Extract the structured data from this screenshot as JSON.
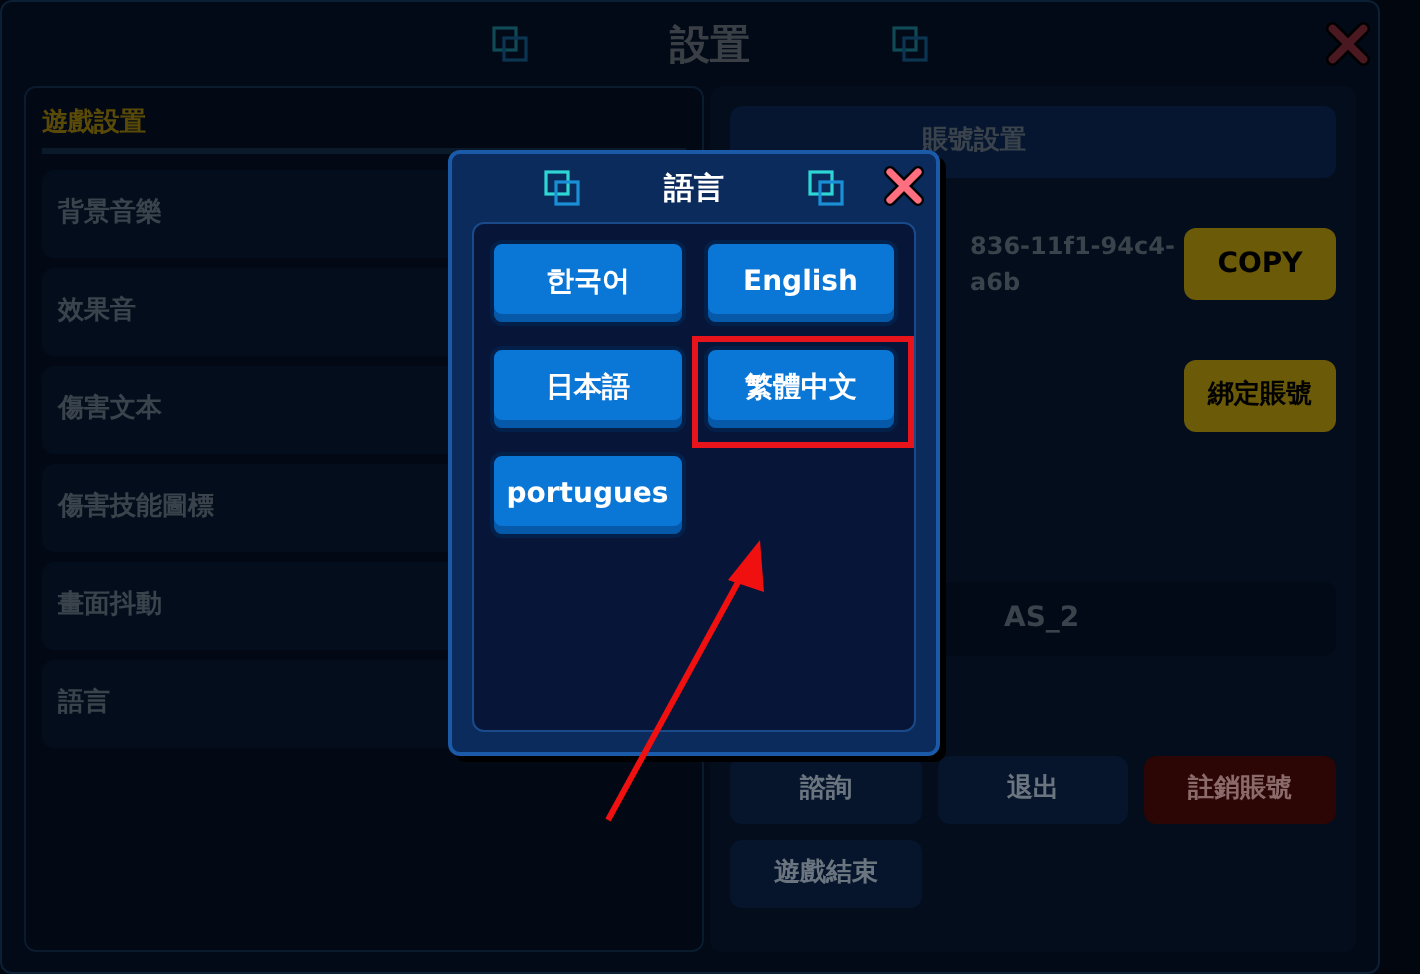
{
  "window": {
    "title": "設置"
  },
  "game_settings": {
    "title": "遊戲設置",
    "items": [
      "背景音樂",
      "效果音",
      "傷害文本",
      "傷害技能圖標",
      "畫面抖動",
      "語言"
    ]
  },
  "account_settings": {
    "title": "賬號設置",
    "account_id_lines": [
      "836-11f1-94c4-",
      "a6b"
    ],
    "copy_button": "COPY",
    "bind_button": "綁定賬號",
    "server": "AS_2",
    "buttons": [
      {
        "label": "諮詢",
        "kind": "normal"
      },
      {
        "label": "退出",
        "kind": "normal"
      },
      {
        "label": "註銷賬號",
        "kind": "danger"
      },
      {
        "label": "遊戲結束",
        "kind": "normal"
      }
    ]
  },
  "language_dialog": {
    "title": "語言",
    "languages": [
      {
        "label": "한국어",
        "highlighted": false
      },
      {
        "label": "English",
        "highlighted": false
      },
      {
        "label": "日本語",
        "highlighted": false
      },
      {
        "label": "繁體中文",
        "highlighted": true
      },
      {
        "label": "portugues",
        "highlighted": false
      }
    ]
  },
  "annotation_arrow": true
}
